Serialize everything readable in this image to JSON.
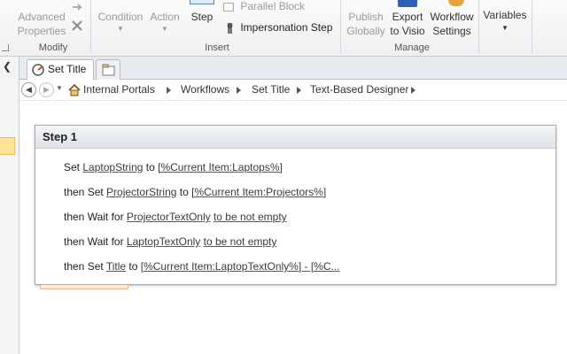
{
  "ribbon": {
    "advanced_properties": "Advanced Properties",
    "advanced_properties_line1": "Advanced",
    "advanced_properties_line2": "Properties",
    "modify_group": "Modify",
    "condition": "Condition",
    "action": "Action",
    "step": "Step",
    "parallel_block": "Parallel Block",
    "impersonation_step": "Impersonation Step",
    "insert_group": "Insert",
    "publish_line1": "Publish",
    "publish_line2": "Globally",
    "export_line1": "Export",
    "export_line2": "to Visio",
    "workflow_line1": "Workflow",
    "workflow_line2": "Settings",
    "manage_group": "Manage",
    "variables": "Variables",
    "accent_color": "#e8a33d"
  },
  "tabs": [
    {
      "label": "Set Title",
      "icon": "workflow-icon"
    },
    {
      "label": "",
      "icon": "folder-icon"
    }
  ],
  "breadcrumb": [
    "Internal Portals",
    "Workflows",
    "Set Title",
    "Text-Based Designer"
  ],
  "step": {
    "title": "Step 1",
    "lines": [
      {
        "pre": "Set ",
        "a": "LaptopString",
        "mid": " to ",
        "b": "[%Current Item:Laptops%]"
      },
      {
        "pre": "then Set ",
        "a": "ProjectorString",
        "mid": " to ",
        "b": "[%Current Item:Projectors%]"
      },
      {
        "pre": "then Wait for ",
        "a": "ProjectorTextOnly",
        "mid": " ",
        "b": "to be not empty"
      },
      {
        "pre": "then Wait for ",
        "a": "LaptopTextOnly",
        "mid": " ",
        "b": "to be not empty"
      },
      {
        "pre": "then Set ",
        "a": "Title",
        "mid": " to ",
        "b": "[%Current Item:LaptopTextOnly%] - [%C..."
      }
    ]
  }
}
